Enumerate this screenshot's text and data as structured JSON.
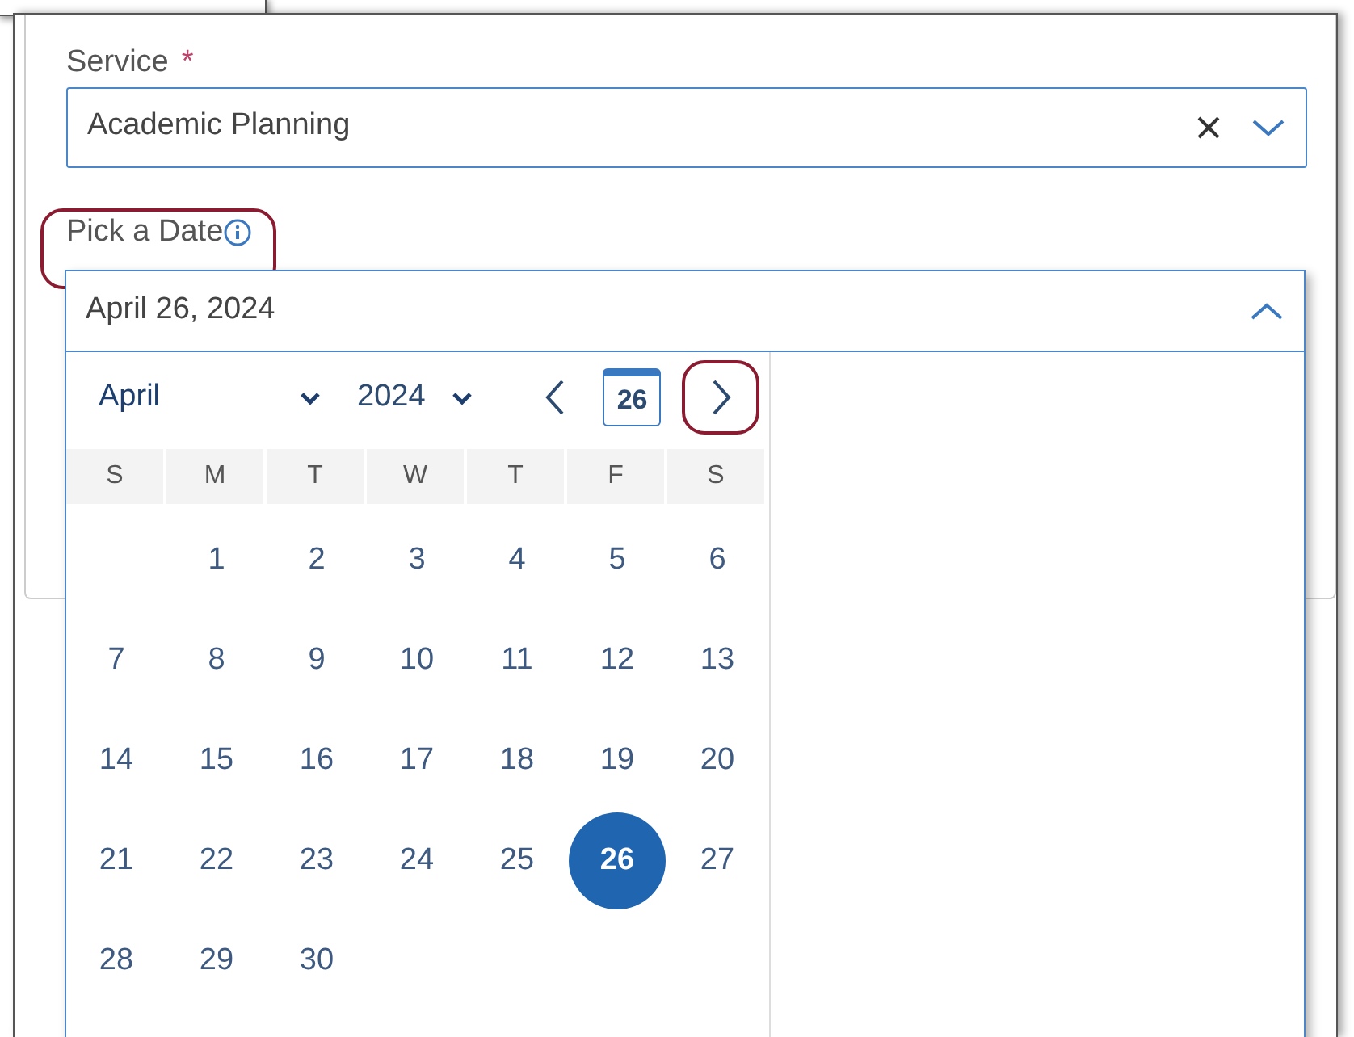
{
  "service": {
    "label": "Service",
    "required_mark": "*",
    "value": "Academic Planning",
    "clearable": true
  },
  "date": {
    "label": "Pick a Date",
    "highlighted": true,
    "value": "April 26, 2024",
    "expanded": true
  },
  "calendar": {
    "month": "April",
    "year": "2024",
    "today": "26",
    "next_highlighted": true,
    "weekdays": [
      "S",
      "M",
      "T",
      "W",
      "T",
      "F",
      "S"
    ],
    "weeks": [
      [
        {
          "kind": "blank"
        },
        {
          "kind": "day",
          "day": "1",
          "selected": false
        },
        {
          "kind": "day",
          "day": "2",
          "selected": false
        },
        {
          "kind": "day",
          "day": "3",
          "selected": false
        },
        {
          "kind": "day",
          "day": "4",
          "selected": false
        },
        {
          "kind": "day",
          "day": "5",
          "selected": false
        },
        {
          "kind": "day",
          "day": "6",
          "selected": false
        }
      ],
      [
        {
          "kind": "day",
          "day": "7",
          "selected": false
        },
        {
          "kind": "day",
          "day": "8",
          "selected": false
        },
        {
          "kind": "day",
          "day": "9",
          "selected": false
        },
        {
          "kind": "day",
          "day": "10",
          "selected": false
        },
        {
          "kind": "day",
          "day": "11",
          "selected": false
        },
        {
          "kind": "day",
          "day": "12",
          "selected": false
        },
        {
          "kind": "day",
          "day": "13",
          "selected": false
        }
      ],
      [
        {
          "kind": "day",
          "day": "14",
          "selected": false
        },
        {
          "kind": "day",
          "day": "15",
          "selected": false
        },
        {
          "kind": "day",
          "day": "16",
          "selected": false
        },
        {
          "kind": "day",
          "day": "17",
          "selected": false
        },
        {
          "kind": "day",
          "day": "18",
          "selected": false
        },
        {
          "kind": "day",
          "day": "19",
          "selected": false
        },
        {
          "kind": "day",
          "day": "20",
          "selected": false
        }
      ],
      [
        {
          "kind": "day",
          "day": "21",
          "selected": false
        },
        {
          "kind": "day",
          "day": "22",
          "selected": false
        },
        {
          "kind": "day",
          "day": "23",
          "selected": false
        },
        {
          "kind": "day",
          "day": "24",
          "selected": false
        },
        {
          "kind": "day",
          "day": "25",
          "selected": false
        },
        {
          "kind": "day",
          "day": "26",
          "selected": true
        },
        {
          "kind": "day",
          "day": "27",
          "selected": false
        }
      ],
      [
        {
          "kind": "day",
          "day": "28",
          "selected": false
        },
        {
          "kind": "day",
          "day": "29",
          "selected": false
        },
        {
          "kind": "day",
          "day": "30",
          "selected": false
        },
        {
          "kind": "blank"
        },
        {
          "kind": "blank"
        },
        {
          "kind": "blank"
        },
        {
          "kind": "blank"
        }
      ]
    ]
  }
}
